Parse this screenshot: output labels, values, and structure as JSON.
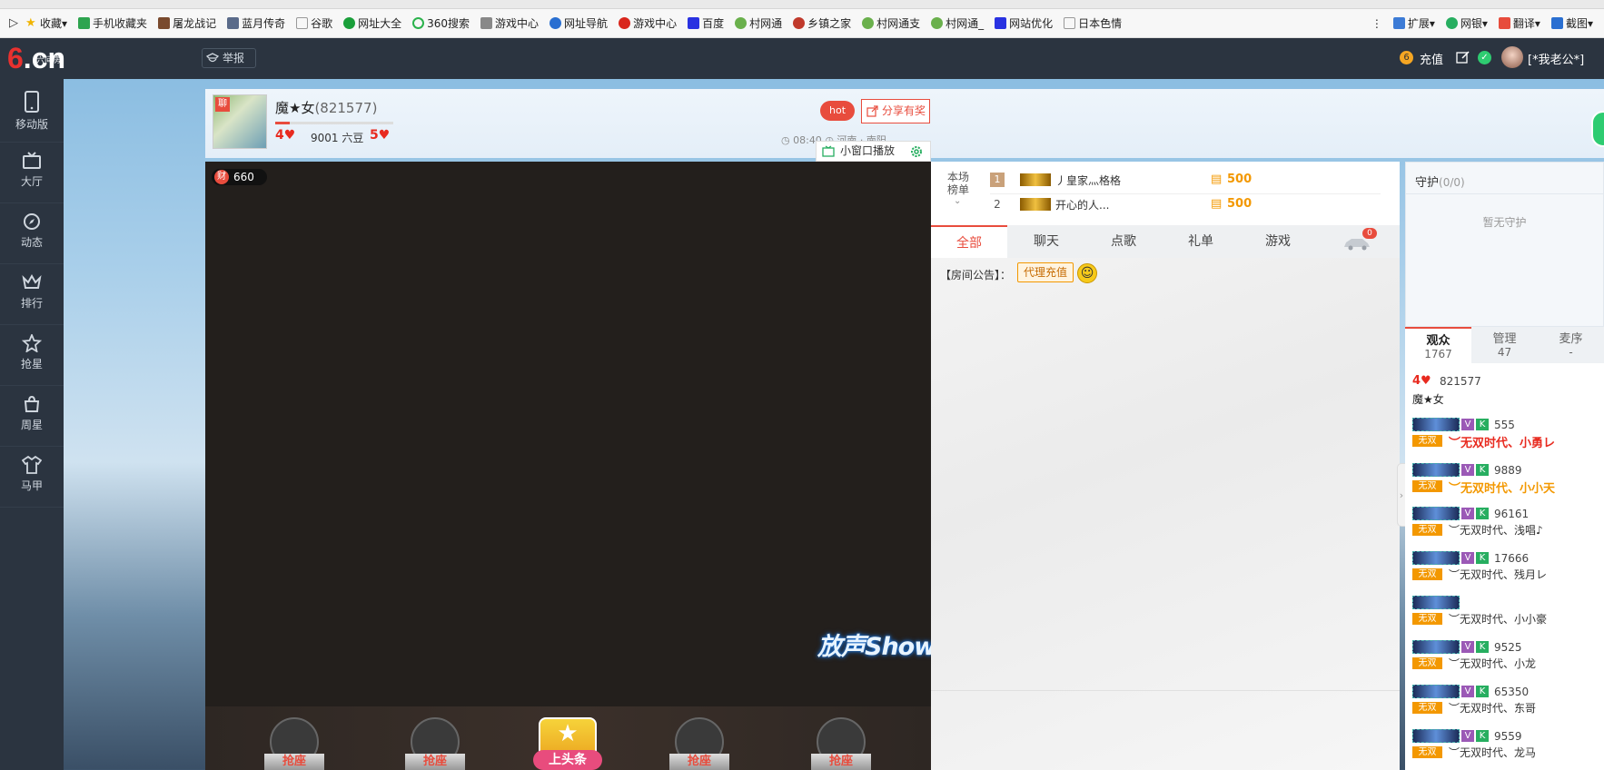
{
  "bookmarks": {
    "items": [
      "收藏",
      "手机收藏夹",
      "屠龙战记",
      "蓝月传奇",
      "谷歌",
      "网址大全",
      "360搜索",
      "游戏中心",
      "网址导航",
      "游戏中心",
      "百度",
      "村网通",
      "乡镇之家",
      "村网通支",
      "村网通_",
      "网站优化",
      "日本色情"
    ],
    "right": [
      "扩展",
      "网银",
      "翻译",
      "截图"
    ]
  },
  "header": {
    "logo": "6.cn",
    "logo_small": "六间房",
    "report": "举报",
    "recharge": "充值",
    "user": "[*我老公*]"
  },
  "sidebar": {
    "items": [
      "移动版",
      "大厅",
      "动态",
      "排行",
      "抢星",
      "周星",
      "马甲"
    ]
  },
  "anchor": {
    "name": "魔★女",
    "id": "(821577)",
    "beans": "9001 六豆",
    "level_left": "4",
    "level_right": "5",
    "time": "08:40",
    "location": "河南 · 南阳",
    "hot": "hot",
    "share": "分享有奖",
    "mini_play": "小窗口播放",
    "avatar_tag": "聊"
  },
  "video": {
    "fortune_label": "财",
    "fortune": "660",
    "show_logo": "放声Show唱",
    "seats": [
      "抢座",
      "抢座",
      "上头条",
      "抢座",
      "抢座"
    ]
  },
  "rank": {
    "label": "本场\n榜单",
    "rows": [
      {
        "n": "1",
        "name": "丿皇家灬格格",
        "score": "500"
      },
      {
        "n": "2",
        "name": "开心的人...",
        "score": "500"
      }
    ]
  },
  "tabs": {
    "items": [
      "全部",
      "聊天",
      "点歌",
      "礼单",
      "游戏"
    ],
    "badge": "0"
  },
  "chat": {
    "notice_label": "【房间公告】：",
    "notice_link": "代理充值"
  },
  "guard": {
    "title": "守护",
    "count": "(0/0)",
    "empty": "暂无守护"
  },
  "audience": {
    "tabs": [
      {
        "label": "观众",
        "count": "1767"
      },
      {
        "label": "管理",
        "count": "47"
      },
      {
        "label": "麦序",
        "count": "-"
      }
    ],
    "host": {
      "id": "821577",
      "name": "魔★女",
      "level": "4"
    },
    "users": [
      {
        "id": "555",
        "name": "︶无双时代、小勇レ",
        "color": "#e82a1f"
      },
      {
        "id": "9889",
        "name": "︶无双时代、小小天",
        "color": "#f39800"
      },
      {
        "id": "96161",
        "name": "︶无双时代、浅唱♪",
        "color": "#333333"
      },
      {
        "id": "17666",
        "name": "︶无双时代、残月レ",
        "color": "#333333"
      },
      {
        "id": "",
        "name": "︶无双时代、小小豪",
        "color": "#333333"
      },
      {
        "id": "9525",
        "name": "︶无双时代、小龙",
        "color": "#333333"
      },
      {
        "id": "65350",
        "name": "︶无双时代、东哥",
        "color": "#333333"
      },
      {
        "id": "9559",
        "name": "︶无双时代、龙马",
        "color": "#333333"
      }
    ],
    "wx": "无双"
  }
}
